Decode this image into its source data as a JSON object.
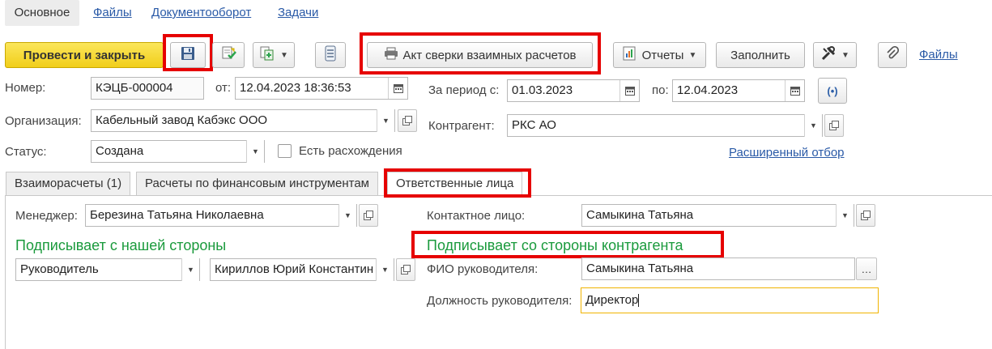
{
  "top_tabs": {
    "main": "Основное",
    "files": "Файлы",
    "docflow": "Документооборот",
    "tasks": "Задачи"
  },
  "toolbar": {
    "post_close": "Провести и закрыть",
    "act_reconciliation": "Акт сверки взаимных расчетов",
    "reports": "Отчеты",
    "fill": "Заполнить",
    "files_link": "Файлы"
  },
  "form": {
    "number_label": "Номер:",
    "number_value": "КЭЦБ-000004",
    "from_label": "от:",
    "date_value": "12.04.2023 18:36:53",
    "period_label": "За период с:",
    "period_from": "01.03.2023",
    "period_to_label": "по:",
    "period_to": "12.04.2023",
    "org_label": "Организация:",
    "org_value": "Кабельный завод Кабэкс ООО",
    "counterparty_label": "Контрагент:",
    "counterparty_value": "РКС АО",
    "status_label": "Статус:",
    "status_value": "Создана",
    "discrepancy_label": "Есть расхождения",
    "advanced_filter": "Расширенный отбор"
  },
  "form_tabs": [
    "Взаиморасчеты (1)",
    "Расчеты по финансовым инструментам",
    "Ответственные лица"
  ],
  "responsible": {
    "manager_label": "Менеджер:",
    "manager_value": "Березина Татьяна Николаевна",
    "contact_label": "Контактное лицо:",
    "contact_value": "Самыкина Татьяна",
    "our_side_title": "Подписывает с нашей стороны",
    "cp_side_title": "Подписывает со стороны контрагента",
    "role_value": "Руководитель",
    "signer_value": "Кириллов Юрий Константин",
    "head_name_label": "ФИО руководителя:",
    "head_name_value": "Самыкина Татьяна",
    "head_pos_label": "Должность руководителя:",
    "head_pos_value": "Директор"
  },
  "colors": {
    "primary_button": "#f4d52b",
    "link": "#2a5aa7",
    "highlight": "#e60000",
    "section_title": "#1a9a3c",
    "focus_border": "#f0b400"
  }
}
